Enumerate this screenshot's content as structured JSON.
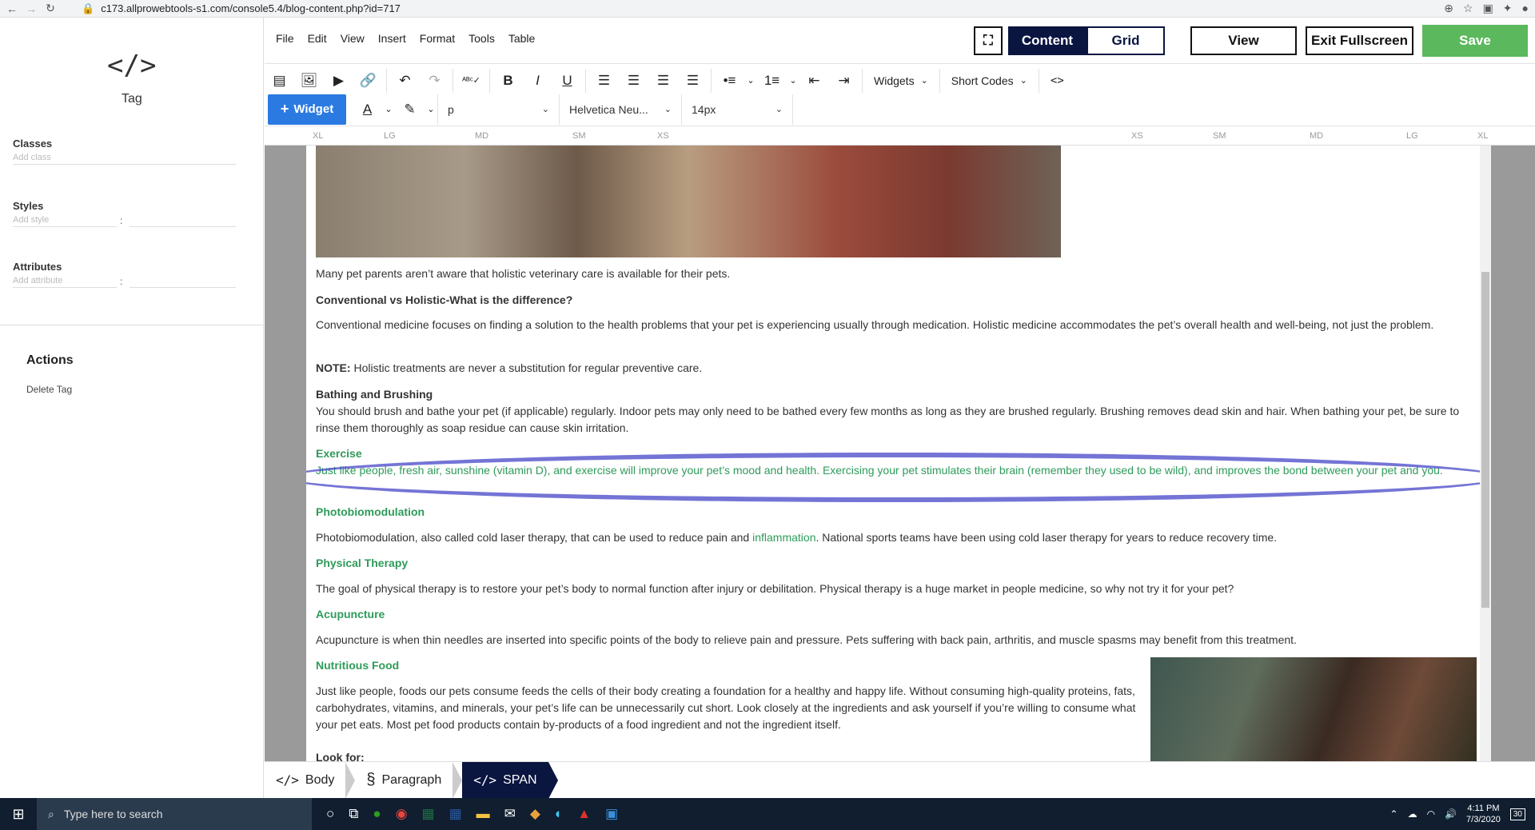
{
  "browser": {
    "url": "c173.allprowebtools-s1.com/console5.4/blog-content.php?id=717"
  },
  "left_panel": {
    "tag_label": "Tag",
    "classes_label": "Classes",
    "classes_placeholder": "Add class",
    "styles_label": "Styles",
    "styles_placeholder": "Add style",
    "attributes_label": "Attributes",
    "attributes_placeholder": "Add attribute",
    "colon": ":",
    "actions_title": "Actions",
    "delete_tag": "Delete Tag"
  },
  "menubar": {
    "items": [
      "File",
      "Edit",
      "View",
      "Insert",
      "Format",
      "Tools",
      "Table"
    ],
    "content_label": "Content",
    "grid_label": "Grid",
    "view_label": "View",
    "exit_fullscreen_label": "Exit Fullscreen",
    "save_label": "Save"
  },
  "toolbar": {
    "widgets_label": "Widgets",
    "short_codes_label": "Short Codes",
    "widget_button": "Widget",
    "block_format": "p",
    "font_family": "Helvetica Neu...",
    "font_size": "14px"
  },
  "ruler": {
    "left": [
      "XL",
      "LG",
      "MD",
      "SM",
      "XS"
    ],
    "right": [
      "XS",
      "SM",
      "MD",
      "LG",
      "XL"
    ]
  },
  "document": {
    "p1": "Many pet parents aren’t aware that holistic veterinary care is available for their pets.",
    "h_conventional": "Conventional vs Holistic-What is the difference?",
    "p2": "Conventional medicine focuses on finding a solution to the health problems that your pet is experiencing usually through medication. Holistic medicine accommodates the pet’s overall health and well-being, not just the problem.",
    "note_label": "NOTE:",
    "note_text": " Holistic treatments are never a substitution for regular preventive care.",
    "h_bathing": "Bathing and Brushing",
    "p_bathing": "You should brush and bathe your pet (if applicable) regularly. Indoor pets may only need to be bathed every few months as long as they are brushed regularly. Brushing removes dead skin and hair. When bathing your pet, be sure to rinse them thoroughly as soap residue can cause skin irritation.",
    "h_exercise": "Exercise",
    "p_exercise": "Just like people, fresh air, sunshine (vitamin D), and exercise will improve your pet’s mood and health. Exercising your pet stimulates their brain (remember they used to be wild), and improves the bond between your pet and you.",
    "h_photo": "Photobiomodulation",
    "p_photo_a": "Photobiomodulation, also called cold laser therapy, that can be used to reduce pain and ",
    "p_photo_link": "inflammation",
    "p_photo_b": ". National sports teams have been using cold laser therapy for years to reduce recovery time.",
    "h_physical": "Physical Therapy",
    "p_physical": "The goal of physical therapy is to restore your pet’s body to normal function after injury or debilitation. Physical therapy is a huge market in people medicine, so why not try it for your pet?",
    "h_acupuncture": "Acupuncture",
    "p_acupuncture": "Acupuncture is when thin needles are inserted into specific points of the body to relieve pain and pressure. Pets suffering with back pain, arthritis, and muscle spasms may benefit from this treatment.",
    "h_nutritious": "Nutritious Food",
    "p_nutritious": "Just like people, foods our pets consume feeds the cells of their body creating a foundation for a healthy and happy life. Without consuming high-quality proteins, fats, carbohydrates, vitamins, and minerals, your pet’s life can be unnecessarily cut short. Look closely at the ingredients and ask yourself if you’re willing to consume what your pet eats. Most pet food products contain by-products of a food ingredient and not the ingredient itself.",
    "h_lookfor": "Look for:"
  },
  "breadcrumb": {
    "body": "Body",
    "paragraph": "Paragraph",
    "span": "SPAN"
  },
  "taskbar": {
    "search_placeholder": "Type here to search",
    "time": "4:11 PM",
    "date": "7/3/2020",
    "notifications": "30"
  },
  "colors": {
    "accent_navy": "#0a1540",
    "save_green": "#5cb85c",
    "widget_blue": "#2a7ae2",
    "link_green": "#2e9b5a"
  }
}
